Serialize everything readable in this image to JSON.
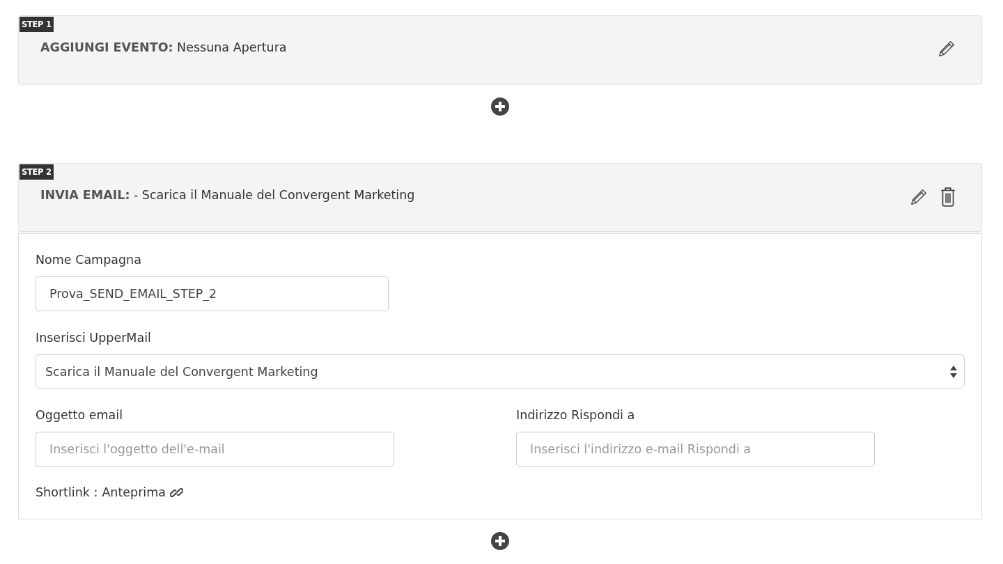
{
  "steps": [
    {
      "badge": "STEP 1",
      "title": "**AGGIUNGI EVENTO:** Nessuna Apertura",
      "actions": [
        {
          "kind": "edit"
        }
      ]
    },
    {
      "badge": "STEP 2",
      "title": "**INVIA EMAIL:** - Scarica il Manuale del Convergent Marketing",
      "actions": [
        {
          "kind": "edit"
        },
        {
          "kind": "delete"
        }
      ],
      "form": {
        "fields": [
          {
            "kind": "text",
            "label": "Nome Campagna",
            "value": "Prova_SEND_EMAIL_STEP_2"
          },
          {
            "kind": "select",
            "label": "Inserisci UpperMail",
            "value": "Scarica il Manuale del Convergent Marketing"
          }
        ],
        "pair": [
          {
            "kind": "text",
            "label": "Oggetto email",
            "placeholder": "Inserisci l'oggetto dell'e-mail"
          },
          {
            "kind": "text",
            "label": "Indirizzo Rispondi a",
            "placeholder": "Inserisci l'indirizzo e-mail Rispondi a"
          }
        ],
        "shortlink": {
          "label": "Shortlink :",
          "link": "Anteprima"
        }
      }
    }
  ]
}
